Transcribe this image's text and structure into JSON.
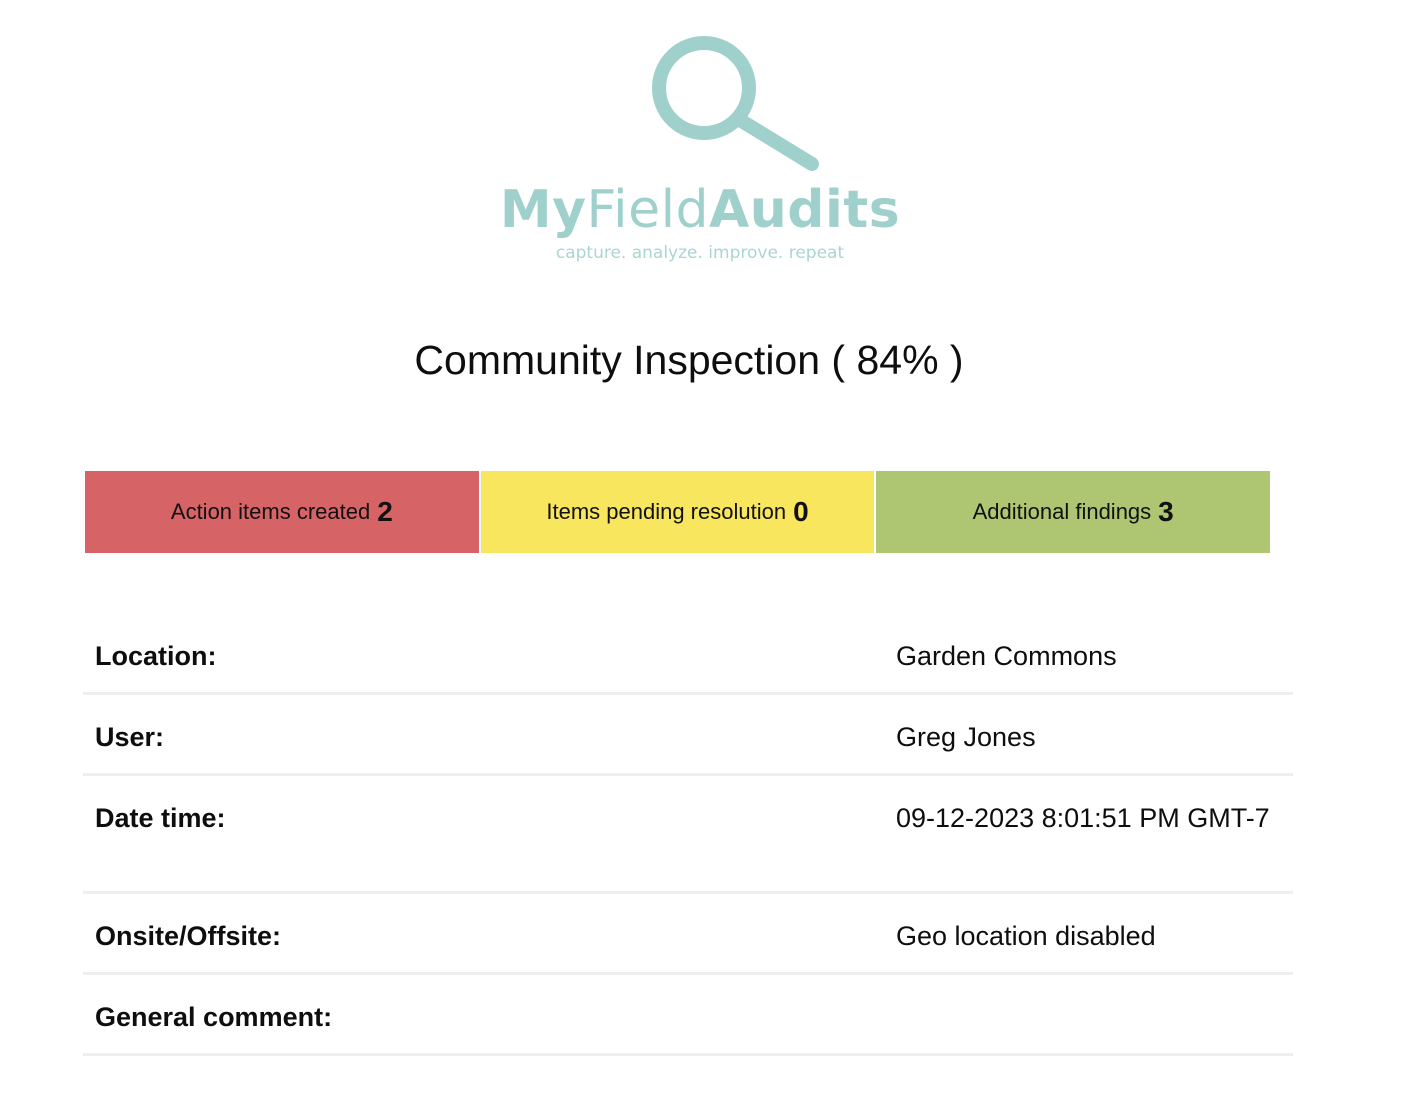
{
  "logo": {
    "word_my": "My",
    "word_field": "Field",
    "word_audits": "Audits",
    "tagline": "capture. analyze. improve. repeat",
    "color": "#9fd0cc"
  },
  "title": "Community Inspection ( 84% )",
  "summary": [
    {
      "label": "Action items created",
      "count": "2",
      "color": "#d66467"
    },
    {
      "label": "Items pending resolution",
      "count": "0",
      "color": "#f8e75e"
    },
    {
      "label": "Additional findings",
      "count": "3",
      "color": "#aec672"
    }
  ],
  "details": [
    {
      "label": "Location:",
      "value": "Garden Commons"
    },
    {
      "label": "User:",
      "value": "Greg Jones"
    },
    {
      "label": "Date time:",
      "value": "09-12-2023 8:01:51 PM GMT-7"
    },
    {
      "label": "Onsite/Offsite:",
      "value": "Geo location disabled"
    },
    {
      "label": "General comment:",
      "value": ""
    }
  ]
}
